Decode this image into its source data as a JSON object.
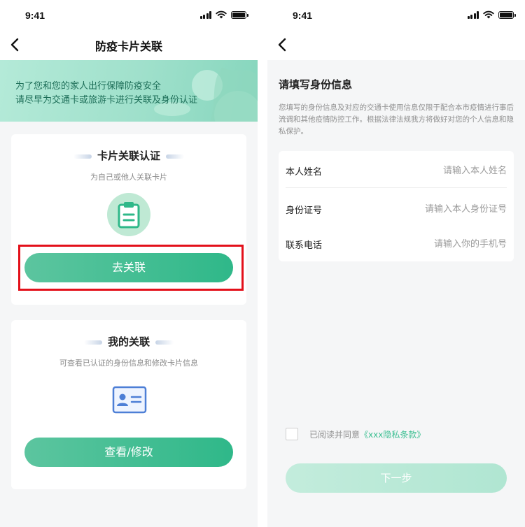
{
  "colors": {
    "accent_green": "#2fb889",
    "accent_green_light": "#5cc59f",
    "highlight_red": "#e3101a",
    "disabled_green": "#c3ecdc"
  },
  "left_screen": {
    "status_time": "9:41",
    "title": "防疫卡片关联",
    "banner": {
      "line1": "为了您和您的家人出行保障防疫安全",
      "line2": "请尽早为交通卡或旅游卡进行关联及身份认证"
    },
    "card_link": {
      "title": "卡片关联认证",
      "subtitle": "为自己或他人关联卡片",
      "icon": "clipboard-icon",
      "button": "去关联"
    },
    "card_mine": {
      "title": "我的关联",
      "subtitle": "可查看已认证的身份信息和修改卡片信息",
      "icon": "id-card-icon",
      "button": "查看/修改"
    }
  },
  "right_screen": {
    "status_time": "9:41",
    "form_title": "请填写身份信息",
    "form_desc": "您填写的身份信息及对应的交通卡使用信息仅限于配合本市疫情进行事后流调和其他疫情防控工作。根据法律法规我方将做好对您的个人信息和隐私保护。",
    "fields": [
      {
        "label": "本人姓名",
        "placeholder": "请输入本人姓名"
      },
      {
        "label": "身份证号",
        "placeholder": "请输入本人身份证号"
      },
      {
        "label": "联系电话",
        "placeholder": "请输入你的手机号"
      }
    ],
    "agree_text": "已阅读并同意",
    "agree_link": "《xxx隐私条款》",
    "next_button": "下一步"
  }
}
